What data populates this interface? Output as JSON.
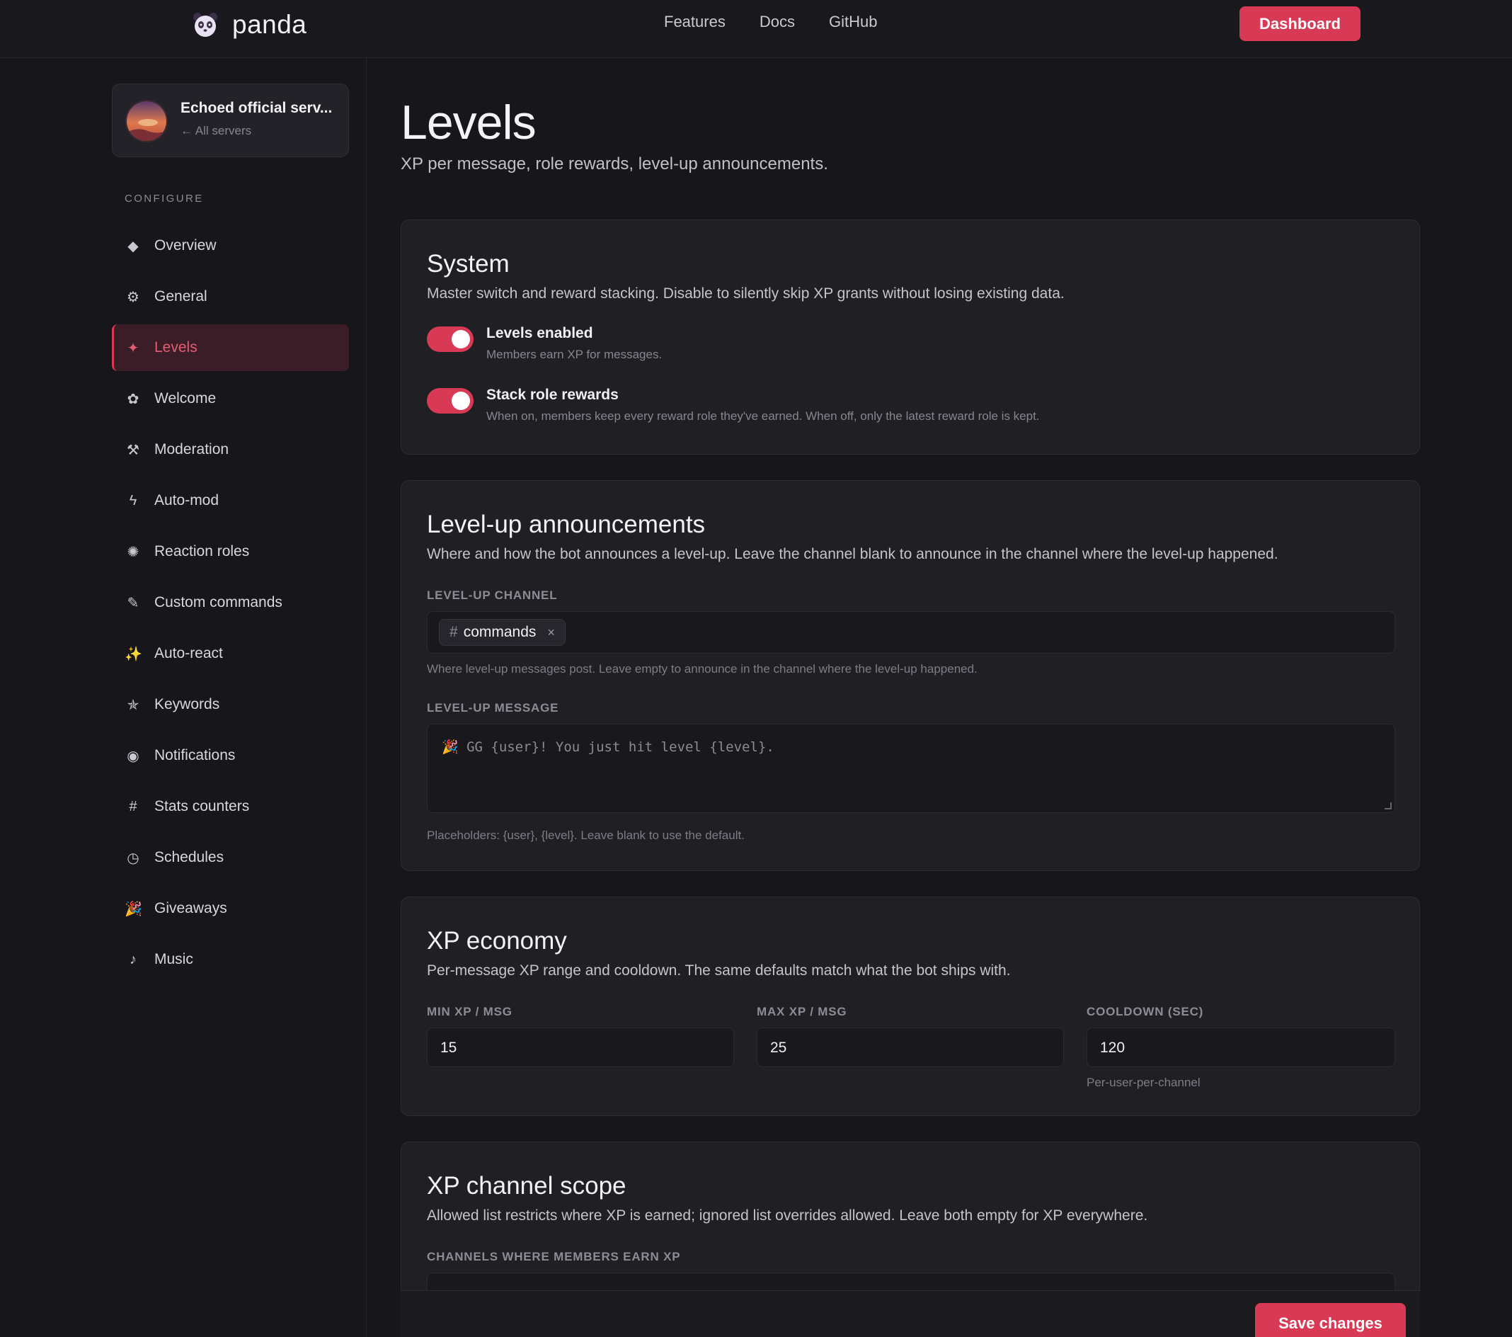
{
  "nav": {
    "brand": "panda",
    "links": [
      "Features",
      "Docs",
      "GitHub"
    ],
    "dashboard_label": "Dashboard"
  },
  "sidebar": {
    "server_name": "Echoed official serv...",
    "back_label": "← All servers",
    "section_label": "CONFIGURE",
    "items": [
      {
        "label": "Overview",
        "icon": "diamond-icon",
        "glyph": "◆"
      },
      {
        "label": "General",
        "icon": "gear-icon",
        "glyph": "⚙"
      },
      {
        "label": "Levels",
        "icon": "sparkle-icon",
        "glyph": "✦",
        "active": true
      },
      {
        "label": "Welcome",
        "icon": "flower-icon",
        "glyph": "✿"
      },
      {
        "label": "Moderation",
        "icon": "hammer-pick-icon",
        "glyph": "⚒"
      },
      {
        "label": "Auto-mod",
        "icon": "lightning-icon",
        "glyph": "ϟ"
      },
      {
        "label": "Reaction roles",
        "icon": "burst-icon",
        "glyph": "✺"
      },
      {
        "label": "Custom commands",
        "icon": "pencil-icon",
        "glyph": "✎"
      },
      {
        "label": "Auto-react",
        "icon": "stars-icon",
        "glyph": "✨"
      },
      {
        "label": "Keywords",
        "icon": "star-icon",
        "glyph": "✯"
      },
      {
        "label": "Notifications",
        "icon": "radio-icon",
        "glyph": "◉"
      },
      {
        "label": "Stats counters",
        "icon": "hash-icon",
        "glyph": "#"
      },
      {
        "label": "Schedules",
        "icon": "clock-icon",
        "glyph": "◷"
      },
      {
        "label": "Giveaways",
        "icon": "party-popper-icon",
        "glyph": "🎉"
      },
      {
        "label": "Music",
        "icon": "music-note-icon",
        "glyph": "♪"
      }
    ]
  },
  "page": {
    "title": "Levels",
    "subtitle": "XP per message, role rewards, level-up announcements."
  },
  "system": {
    "title": "System",
    "desc": "Master switch and reward stacking. Disable to silently skip XP grants without losing existing data.",
    "toggles": [
      {
        "title": "Levels enabled",
        "desc": "Members earn XP for messages.",
        "on": true
      },
      {
        "title": "Stack role rewards",
        "desc": "When on, members keep every reward role they've earned. When off, only the latest reward role is kept.",
        "on": true
      }
    ]
  },
  "announcements": {
    "title": "Level-up announcements",
    "desc": "Where and how the bot announces a level-up. Leave the channel blank to announce in the channel where the level-up happened.",
    "channel_label": "LEVEL-UP CHANNEL",
    "channel_chip": "commands",
    "channel_hash": "#",
    "chip_remove": "×",
    "channel_help": "Where level-up messages post. Leave empty to announce in the channel where the level-up happened.",
    "message_label": "LEVEL-UP MESSAGE",
    "message_placeholder": "🎉 GG {user}! You just hit level {level}.",
    "message_help": "Placeholders: {user}, {level}. Leave blank to use the default."
  },
  "economy": {
    "title": "XP economy",
    "desc": "Per-message XP range and cooldown. The same defaults match what the bot ships with.",
    "fields": [
      {
        "label": "MIN XP / MSG",
        "value": "15"
      },
      {
        "label": "MAX XP / MSG",
        "value": "25"
      },
      {
        "label": "COOLDOWN (SEC)",
        "value": "120"
      }
    ],
    "cooldown_help": "Per-user-per-channel"
  },
  "scope": {
    "title": "XP channel scope",
    "desc": "Allowed list restricts where XP is earned; ignored list overrides allowed. Leave both empty for XP everywhere.",
    "allowed_label": "CHANNELS WHERE MEMBERS EARN XP"
  },
  "save_label": "Save changes",
  "colors": {
    "accent": "#d83a56",
    "background": "#17171b",
    "card": "#1f1f24"
  }
}
